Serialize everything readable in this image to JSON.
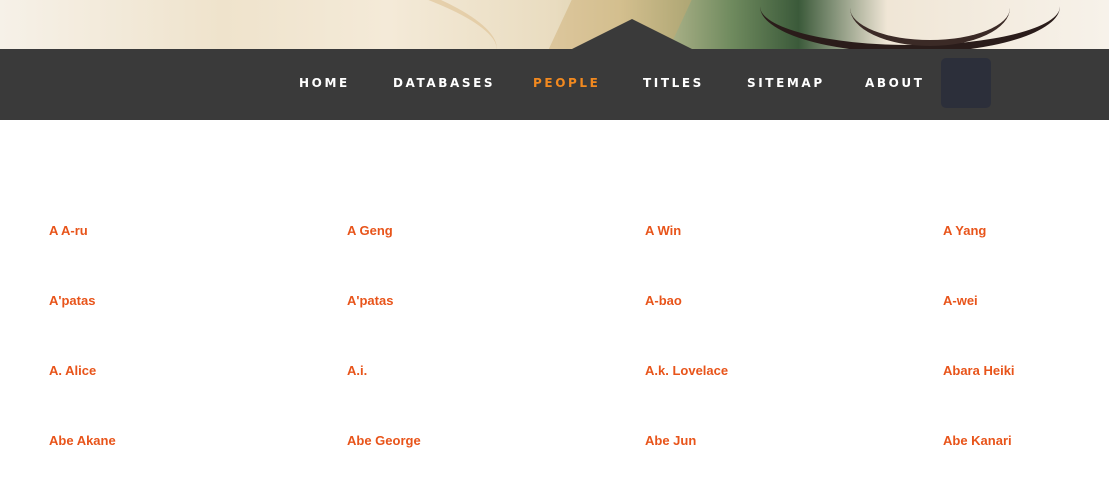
{
  "nav": {
    "items": [
      {
        "label": "HOME"
      },
      {
        "label": "DATABASES"
      },
      {
        "label": "PEOPLE"
      },
      {
        "label": "TITLES"
      },
      {
        "label": "SITEMAP"
      },
      {
        "label": "ABOUT"
      }
    ],
    "active": "PEOPLE"
  },
  "colors": {
    "accent": "#f2891f",
    "link": "#e8541a",
    "nav_background": "#3a3a3a",
    "search_button": "#2c2f3a"
  },
  "people": [
    "A A-ru",
    "A Geng",
    "A Win",
    "A Yang",
    "A'patas",
    "A'patas",
    "A-bao",
    "A-wei",
    "A. Alice",
    "A.i.",
    "A.k. Lovelace",
    "Abara Heiki",
    "Abe Akane",
    "Abe George",
    "Abe Jun",
    "Abe Kanari"
  ]
}
